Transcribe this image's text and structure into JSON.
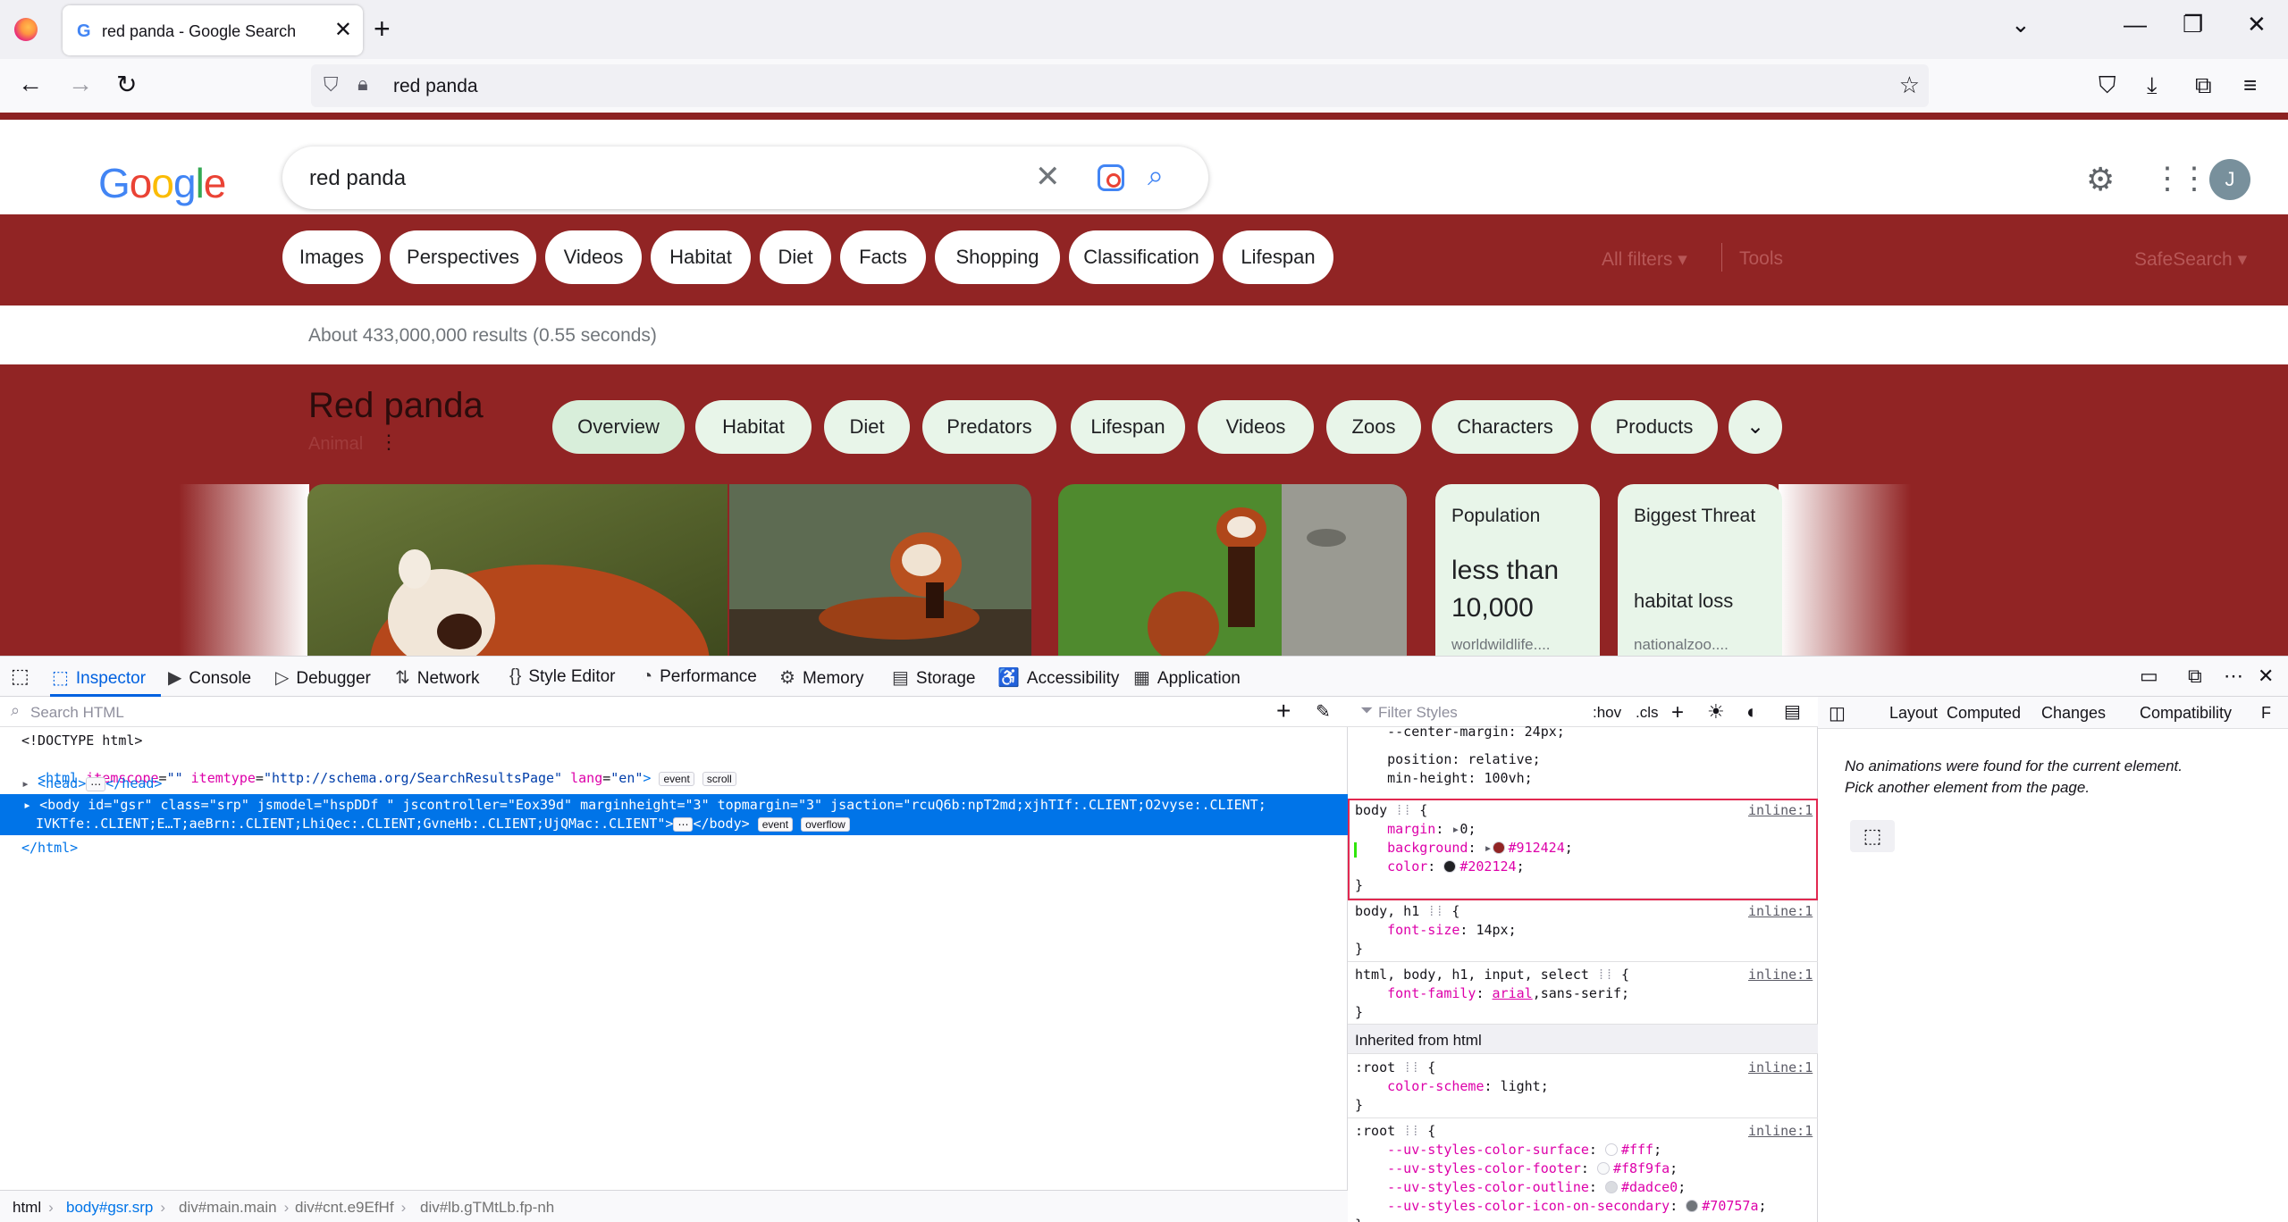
{
  "browser": {
    "tab_title": "red panda - Google Search",
    "tab_favicon": "G",
    "url": "red panda",
    "icons": {
      "firefox": "firefox-logo-icon",
      "close_tab": "✕",
      "new_tab": "+",
      "list_tabs": "⌄",
      "minimize": "—",
      "restore": "❐",
      "close_window": "✕",
      "back": "←",
      "forward": "→",
      "reload": "↻",
      "shield": "⛉",
      "lock": "🔒︎",
      "bookmark": "☆",
      "pocket": "⛉",
      "downloads": "⤓",
      "extensions": "⧉",
      "menu": "≡"
    }
  },
  "google": {
    "logo_letters": [
      {
        "ch": "G",
        "color": "#4285f4"
      },
      {
        "ch": "o",
        "color": "#ea4335"
      },
      {
        "ch": "o",
        "color": "#fbbc05"
      },
      {
        "ch": "g",
        "color": "#4285f4"
      },
      {
        "ch": "l",
        "color": "#34a853"
      },
      {
        "ch": "e",
        "color": "#ea4335"
      }
    ],
    "query": "red panda",
    "avatar_initial": "J",
    "chips": [
      "Images",
      "Perspectives",
      "Videos",
      "Habitat",
      "Diet",
      "Facts",
      "Shopping",
      "Classification",
      "Lifespan"
    ],
    "all_filters": "All filters",
    "tools": "Tools",
    "safesearch": "SafeSearch",
    "stats": "About 433,000,000 results (0.55 seconds)",
    "knowledge_panel": {
      "title": "Red panda",
      "subtitle": "Animal",
      "tabs": [
        "Overview",
        "Habitat",
        "Diet",
        "Predators",
        "Lifespan",
        "Videos",
        "Zoos",
        "Characters",
        "Products"
      ],
      "cards": [
        {
          "heading": "Population",
          "value": "less than 10,000",
          "source": "worldwildlife...."
        },
        {
          "heading": "Biggest Threat",
          "value": "habitat loss",
          "source": "nationalzoo...."
        }
      ]
    },
    "colors": {
      "page_background": "#912424",
      "chip": "#ffffff",
      "kp_chip": "#e8f5e9"
    }
  },
  "devtools": {
    "tabs": [
      "Inspector",
      "Console",
      "Debugger",
      "Network",
      "Style Editor",
      "Performance",
      "Memory",
      "Storage",
      "Accessibility",
      "Application"
    ],
    "active_tab": "Inspector",
    "search_html_placeholder": "Search HTML",
    "markup": {
      "doctype": "<!DOCTYPE html>",
      "html_open_tag": "html",
      "html_attrs": [
        {
          "name": "itemscope",
          "value": "\"\""
        },
        {
          "name": "itemtype",
          "value": "\"http://schema.org/SearchResultsPage\""
        },
        {
          "name": "lang",
          "value": "\"en\""
        }
      ],
      "html_badges": [
        "event",
        "scroll"
      ],
      "head_line": "<head>",
      "head_close": "</head>",
      "body_line1": "<body id=\"gsr\" class=\"srp\" jsmodel=\"hspDDf \" jscontroller=\"Eox39d\" marginheight=\"3\" topmargin=\"3\" jsaction=\"rcuQ6b:npT2md;xjhTIf:.CLIENT;O2vyse:.CLIENT;",
      "body_line2": "IVKTfe:.CLIENT;E…T;aeBrn:.CLIENT;LhiQec:.CLIENT;GvneHb:.CLIENT;UjQMac:.CLIENT\">",
      "body_close": "</body>",
      "body_badges": [
        "event",
        "overflow"
      ],
      "html_close": "</html>"
    },
    "breadcrumbs": [
      "html",
      "body#gsr.srp",
      "div#main.main",
      "div#cnt.e9EfHf",
      "div#lb.gTMtLb.fp-nh"
    ],
    "rules": {
      "filter_placeholder": "Filter Styles",
      "hov": ":hov",
      "cls": ".cls",
      "top_partial": [
        "--center-margin: 24px;",
        "position: relative;",
        "min-height: 100vh;"
      ],
      "blocks": [
        {
          "selector": "body",
          "source": "inline:1",
          "props": [
            {
              "name": "margin",
              "value": "0",
              "expander": true
            },
            {
              "name": "background",
              "value": "#912424",
              "expander": true,
              "swatch": "#912424"
            },
            {
              "name": "color",
              "value": "#202124",
              "swatch": "#202124"
            }
          ]
        },
        {
          "selector": "body, h1",
          "source": "inline:1",
          "props": [
            {
              "name": "font-size",
              "value": "14px"
            }
          ]
        },
        {
          "selector": "html, body, h1, input, select",
          "source": "inline:1",
          "props": [
            {
              "name": "font-family",
              "value": "arial",
              "value2": ",sans-serif"
            }
          ]
        }
      ],
      "inherited_label": "Inherited from html",
      "root_blocks": [
        {
          "selector": ":root",
          "source": "inline:1",
          "props": [
            {
              "name": "color-scheme",
              "value": "light"
            }
          ]
        },
        {
          "selector": ":root",
          "source": "inline:1",
          "props": [
            {
              "name": "--uv-styles-color-surface",
              "value": "#fff",
              "swatch": "#ffffff"
            },
            {
              "name": "--uv-styles-color-footer",
              "value": "#f8f9fa",
              "swatch": "#f8f9fa"
            },
            {
              "name": "--uv-styles-color-outline",
              "value": "#dadce0",
              "swatch": "#dadce0"
            },
            {
              "name": "--uv-styles-color-icon-on-secondary",
              "value": "#70757a",
              "swatch": "#70757a"
            }
          ]
        }
      ]
    },
    "side_tabs": [
      "Layout",
      "Computed",
      "Changes",
      "Compatibility",
      "F"
    ],
    "animation_message_line1": "No animations were found for the current element.",
    "animation_message_line2": "Pick another element from the page."
  }
}
